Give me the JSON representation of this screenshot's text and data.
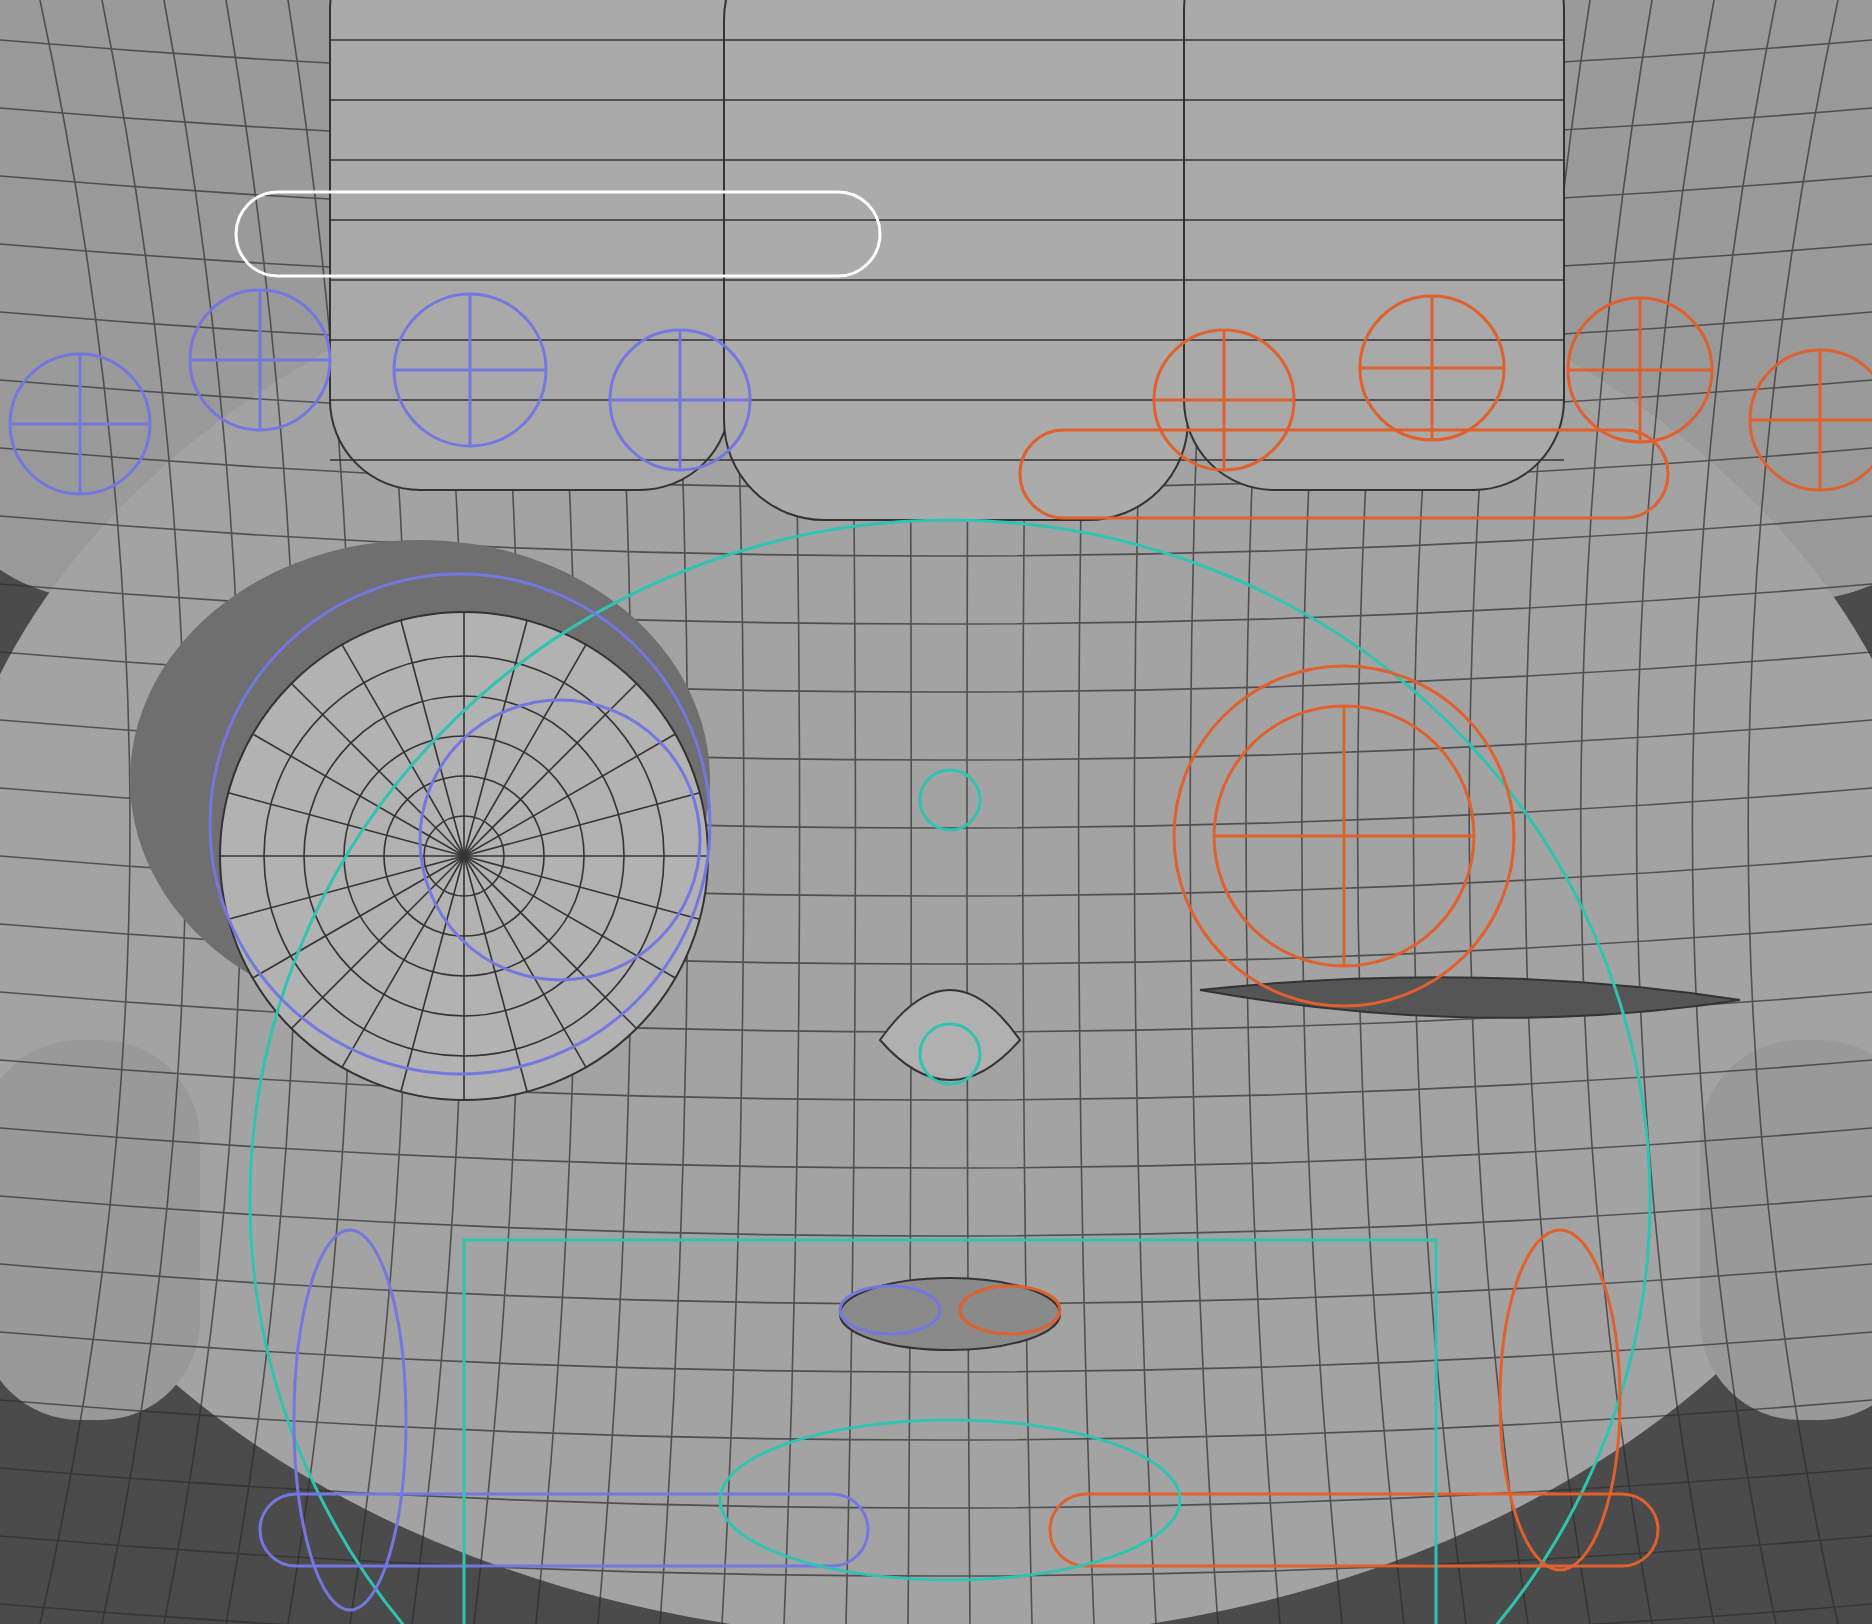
{
  "viewport": {
    "rig_controls": [
      {
        "kind": "capsule",
        "color": "#ffffff"
      },
      {
        "kind": "cross-circle",
        "color": "#7378e0"
      },
      {
        "kind": "cross-circle",
        "color": "#7378e0"
      },
      {
        "kind": "cross-circle",
        "color": "#7378e0"
      },
      {
        "kind": "cross-circle",
        "color": "#7378e0"
      },
      {
        "kind": "cross-circle",
        "color": "#e0602e"
      },
      {
        "kind": "cross-circle",
        "color": "#e0602e"
      },
      {
        "kind": "cross-circle",
        "color": "#e0602e"
      },
      {
        "kind": "cross-circle",
        "color": "#e0602e"
      },
      {
        "kind": "capsule",
        "color": "#e0602e"
      },
      {
        "kind": "ellipse",
        "color": "#2fc4b2"
      },
      {
        "kind": "circle",
        "color": "#2fc4b2"
      },
      {
        "kind": "circle",
        "color": "#2fc4b2"
      },
      {
        "kind": "cross-circle",
        "color": "#e0602e"
      },
      {
        "kind": "circle",
        "color": "#e0602e"
      },
      {
        "kind": "circle",
        "color": "#7378e0"
      },
      {
        "kind": "circle",
        "color": "#7378e0"
      },
      {
        "kind": "ellipse",
        "color": "#7378e0"
      },
      {
        "kind": "ellipse",
        "color": "#e0602e"
      },
      {
        "kind": "capsule",
        "color": "#7378e0"
      },
      {
        "kind": "capsule",
        "color": "#e0602e"
      },
      {
        "kind": "rect",
        "color": "#2fc4b2"
      },
      {
        "kind": "ellipse",
        "color": "#2fc4b2"
      },
      {
        "kind": "ellipse",
        "color": "#7378e0"
      },
      {
        "kind": "ellipse",
        "color": "#e0602e"
      }
    ]
  }
}
